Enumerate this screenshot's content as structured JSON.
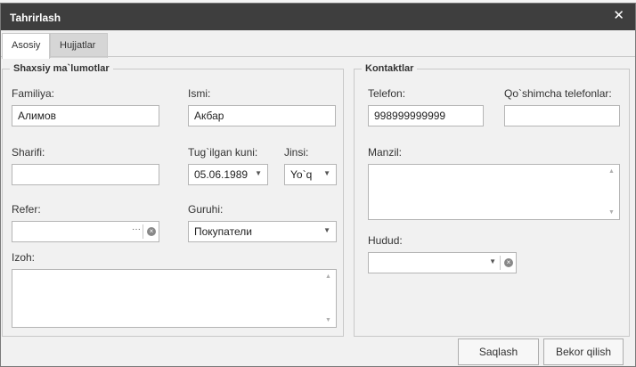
{
  "window": {
    "title": "Tahrirlash",
    "close_symbol": "✕"
  },
  "tabs": [
    {
      "label": "Asosiy",
      "active": true
    },
    {
      "label": "Hujjatlar",
      "active": false
    }
  ],
  "personal": {
    "legend": "Shaxsiy ma`lumotlar",
    "lastname_label": "Familiya:",
    "lastname_value": "Алимов",
    "firstname_label": "Ismi:",
    "firstname_value": "Акбар",
    "patronymic_label": "Sharifi:",
    "patronymic_value": "",
    "birthdate_label": "Tug`ilgan kuni:",
    "birthdate_value": "05.06.1989",
    "gender_label": "Jinsi:",
    "gender_value": "Yo`q",
    "referer_label": "Refer:",
    "referer_value": "",
    "referer_ellipsis": "···",
    "group_label": "Guruhi:",
    "group_value": "Покупатели",
    "note_label": "Izoh:",
    "note_value": ""
  },
  "contacts": {
    "legend": "Kontaktlar",
    "phone_label": "Telefon:",
    "phone_value": "998999999999",
    "extra_phones_label": "Qo`shimcha telefonlar:",
    "extra_phones_value": "",
    "address_label": "Manzil:",
    "address_value": "",
    "region_label": "Hudud:",
    "region_value": ""
  },
  "buttons": {
    "save": "Saqlash",
    "cancel": "Bekor qilish"
  }
}
